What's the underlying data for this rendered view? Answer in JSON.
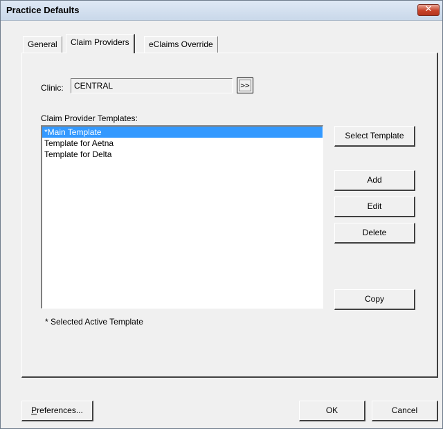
{
  "window": {
    "title": "Practice Defaults",
    "close_glyph": "✕",
    "close_color": "#c7432a"
  },
  "tabs": [
    {
      "label": "General",
      "active": false
    },
    {
      "label": "Claim Providers",
      "active": true
    },
    {
      "label": "eClaims Override",
      "active": false
    }
  ],
  "clinic": {
    "label": "Clinic:",
    "value": "CENTRAL",
    "browse_label": ">>"
  },
  "templates": {
    "label": "Claim Provider Templates:",
    "items": [
      "*Main Template",
      "Template for Aetna",
      "Template for Delta"
    ],
    "selected_index": 0,
    "selection_color": "#3399ff",
    "footnote": "* Selected Active Template"
  },
  "buttons": {
    "select_template": "Select Template",
    "add": "Add",
    "edit": "Edit",
    "delete": "Delete",
    "copy": "Copy",
    "preferences": "Preferences...",
    "ok": "OK",
    "cancel": "Cancel"
  }
}
